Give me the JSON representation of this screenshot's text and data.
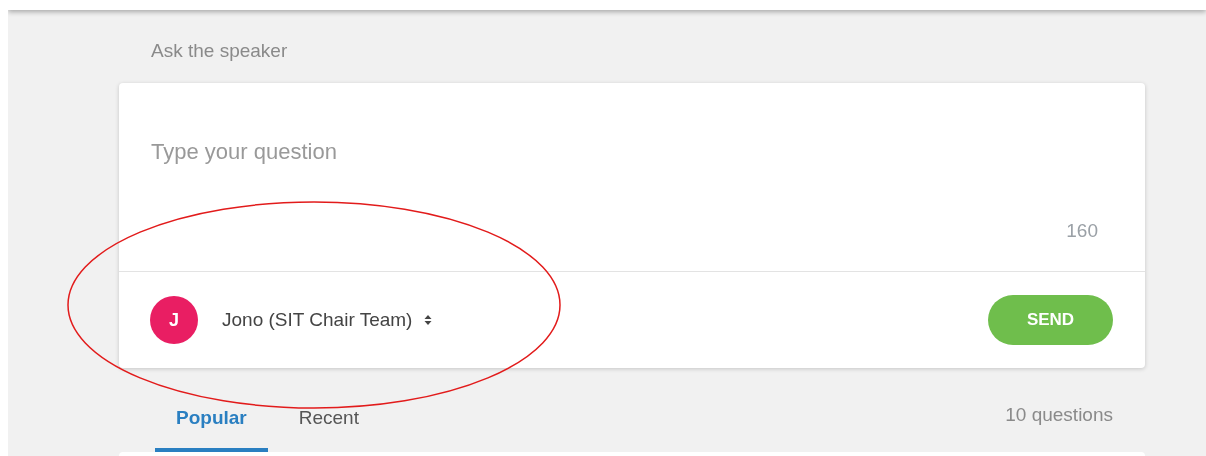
{
  "section_title": "Ask the speaker",
  "question_field": {
    "placeholder": "Type your question"
  },
  "char_counter": "160",
  "author": {
    "initial": "J",
    "name": "Jono (SIT Chair Team)",
    "color": "#e91e63"
  },
  "send_button": "SEND",
  "tabs": [
    {
      "label": "Popular",
      "selected": true
    },
    {
      "label": "Recent",
      "selected": false
    }
  ],
  "question_count": "10 questions"
}
